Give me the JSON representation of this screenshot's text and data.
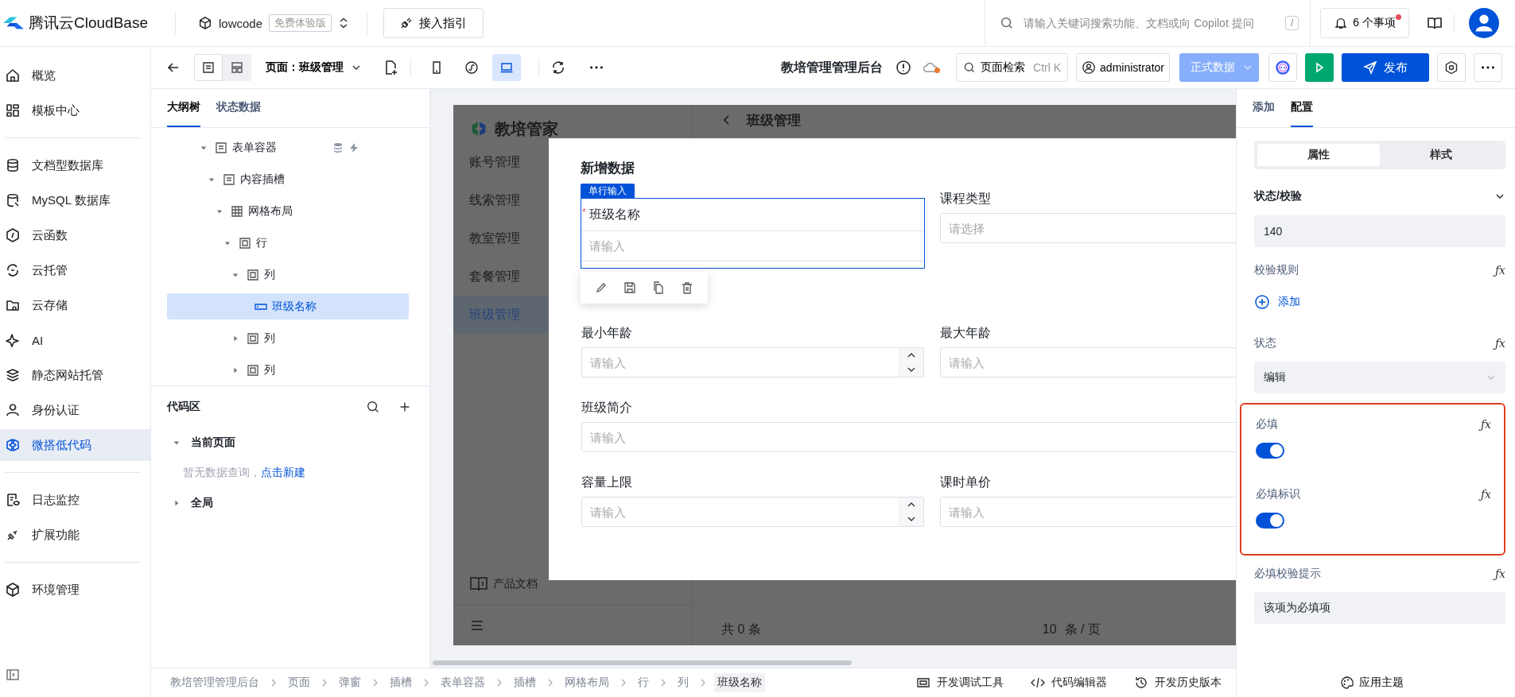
{
  "topbar": {
    "brand": "腾讯云CloudBase",
    "env": "lowcode",
    "env_badge": "免费体验版",
    "guide_button": "接入指引",
    "search": {
      "placeholder": "请输入关键词搜索功能、文档或向 Copilot 提问",
      "shortcut": "/"
    },
    "notifications": {
      "label": "6 个事项",
      "unread": true
    }
  },
  "nav": {
    "groups": [
      [
        {
          "label": "概览",
          "selected": false
        },
        {
          "label": "模板中心",
          "selected": false
        }
      ],
      [
        {
          "label": "文档型数据库",
          "selected": false
        },
        {
          "label": "MySQL 数据库",
          "selected": false
        },
        {
          "label": "云函数",
          "selected": false
        },
        {
          "label": "云托管",
          "selected": false
        },
        {
          "label": "云存储",
          "selected": false
        },
        {
          "label": "AI",
          "selected": false
        },
        {
          "label": "静态网站托管",
          "selected": false
        },
        {
          "label": "身份认证",
          "selected": false
        },
        {
          "label": "微搭低代码",
          "selected": true
        }
      ],
      [
        {
          "label": "日志监控",
          "selected": false
        },
        {
          "label": "扩展功能",
          "selected": false
        }
      ],
      [
        {
          "label": "环境管理",
          "selected": false
        }
      ]
    ]
  },
  "toolbar": {
    "view_modes": [
      {
        "selected": true
      },
      {
        "selected": false
      }
    ],
    "page_select": "页面：班级管理",
    "devices": [
      {
        "kind": "mobile",
        "selected": false
      },
      {
        "kind": "miniprogram",
        "selected": false
      },
      {
        "kind": "desktop",
        "selected": true
      }
    ],
    "app_title": "教培管理管理后台",
    "unsaved": true,
    "page_search": "页面检索",
    "page_search_shortcut": "Ctrl K",
    "user": "administrator",
    "data_env": "正式数据",
    "publish": "发布"
  },
  "outline": {
    "tabs": [
      {
        "label": "大纲树",
        "selected": true
      },
      {
        "label": "状态数据",
        "selected": false
      }
    ],
    "tree": [
      {
        "label": "表单容器",
        "kind": "form",
        "expanded": true,
        "selected": false,
        "has_bindings": true,
        "children": [
          {
            "label": "内容插槽",
            "kind": "form",
            "expanded": true,
            "selected": false,
            "children": [
              {
                "label": "网格布局",
                "kind": "grid",
                "expanded": true,
                "selected": false,
                "children": [
                  {
                    "label": "行",
                    "kind": "box",
                    "expanded": true,
                    "selected": false,
                    "children": [
                      {
                        "label": "列",
                        "kind": "box",
                        "expanded": true,
                        "selected": false,
                        "children": [
                          {
                            "label": "班级名称",
                            "kind": "input",
                            "selected": true
                          }
                        ]
                      },
                      {
                        "label": "列",
                        "kind": "box",
                        "expanded": false,
                        "selected": false
                      },
                      {
                        "label": "列",
                        "kind": "box",
                        "expanded": false,
                        "selected": false
                      }
                    ]
                  }
                ]
              }
            ]
          }
        ]
      }
    ],
    "code_area": {
      "title": "代码区",
      "groups": [
        {
          "label": "当前页面",
          "expanded": true,
          "empty_text": "暂无数据查询，",
          "link": "点击新建"
        },
        {
          "label": "全局",
          "expanded": false
        }
      ]
    }
  },
  "preview": {
    "app_name": "教培管家",
    "menu": [
      {
        "label": "账号管理",
        "selected": false
      },
      {
        "label": "线索管理",
        "selected": false
      },
      {
        "label": "教室管理",
        "selected": false
      },
      {
        "label": "套餐管理",
        "selected": false
      },
      {
        "label": "班级管理",
        "selected": true
      }
    ],
    "docs": "产品文档",
    "page_title": "班级管理",
    "pagination": {
      "total": "共 0 条",
      "page_size": "10",
      "per_page": "条 / 页"
    }
  },
  "modal": {
    "title": "新增数据",
    "selected_badge": "单行输入",
    "required_mark": "*",
    "fields": [
      {
        "label": "班级名称",
        "kind": "text",
        "placeholder": "请输入",
        "required": true,
        "selected": true,
        "full_width": false
      },
      {
        "label": "课程类型",
        "kind": "select",
        "placeholder": "请选择",
        "required": false,
        "selected": false,
        "full_width": false
      },
      {
        "label": "最小年龄",
        "kind": "number",
        "placeholder": "请输入",
        "required": false,
        "selected": false,
        "full_width": false
      },
      {
        "label": "最大年龄",
        "kind": "text",
        "placeholder": "请输入",
        "required": false,
        "selected": false,
        "full_width": false
      },
      {
        "label": "班级简介",
        "kind": "text",
        "placeholder": "请输入",
        "required": false,
        "selected": false,
        "full_width": true
      },
      {
        "label": "容量上限",
        "kind": "number",
        "placeholder": "请输入",
        "required": false,
        "selected": false,
        "full_width": false
      },
      {
        "label": "课时单价",
        "kind": "text",
        "placeholder": "请输入",
        "required": false,
        "selected": false,
        "full_width": false
      }
    ]
  },
  "config": {
    "tabs": [
      {
        "label": "添加",
        "selected": false
      },
      {
        "label": "配置",
        "selected": true
      }
    ],
    "segments": [
      {
        "label": "属性",
        "selected": true
      },
      {
        "label": "样式",
        "selected": false
      }
    ],
    "section": {
      "title": "状态/校验",
      "expanded": true
    },
    "items": [
      {
        "kind": "value",
        "value": "140"
      },
      {
        "kind": "label",
        "label": "校验规则",
        "formula": "ƒx"
      },
      {
        "kind": "add",
        "label": "添加"
      },
      {
        "kind": "label",
        "label": "状态",
        "formula": "ƒx"
      },
      {
        "kind": "select",
        "value": "编辑"
      },
      {
        "kind": "group",
        "highlighted": true,
        "children": [
          {
            "kind": "label",
            "label": "必填",
            "formula": "ƒx"
          },
          {
            "kind": "switch",
            "on": true
          },
          {
            "kind": "label",
            "label": "必填标识",
            "formula": "ƒx"
          },
          {
            "kind": "switch",
            "on": true
          }
        ]
      },
      {
        "kind": "label",
        "label": "必填校验提示",
        "formula": "ƒx"
      },
      {
        "kind": "value",
        "value": "该项为必填项"
      }
    ],
    "theme_button": "应用主题"
  },
  "bottom_bar": {
    "breadcrumb": [
      {
        "label": "教培管理管理后台",
        "selected": false
      },
      {
        "label": "页面",
        "selected": false
      },
      {
        "label": "弹窗",
        "selected": false
      },
      {
        "label": "插槽",
        "selected": false
      },
      {
        "label": "表单容器",
        "selected": false
      },
      {
        "label": "插槽",
        "selected": false
      },
      {
        "label": "网格布局",
        "selected": false
      },
      {
        "label": "行",
        "selected": false
      },
      {
        "label": "列",
        "selected": false
      },
      {
        "label": "班级名称",
        "selected": true
      }
    ],
    "tools": [
      "开发调试工具",
      "代码编辑器",
      "开发历史版本"
    ]
  }
}
